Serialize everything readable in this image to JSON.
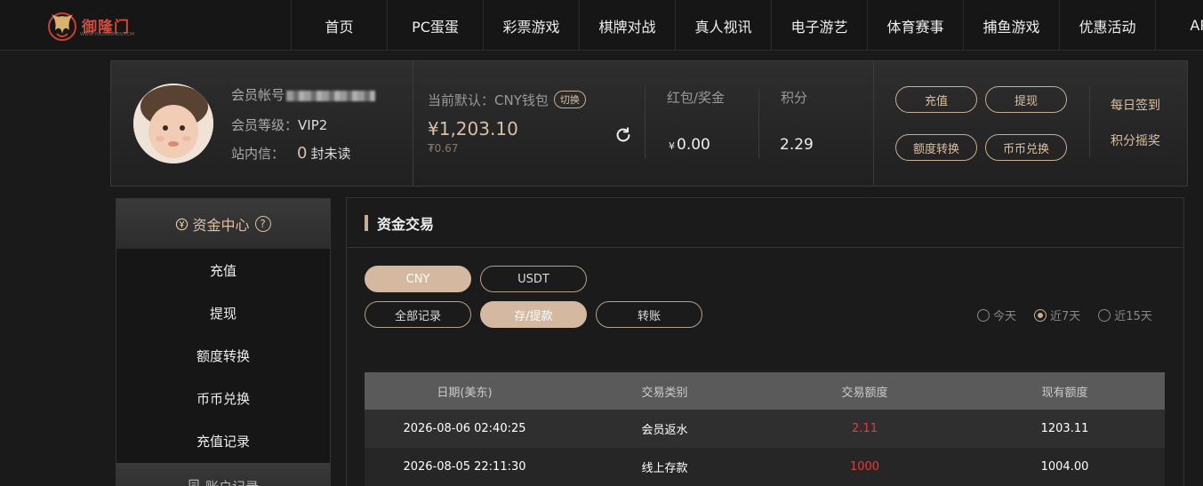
{
  "nav": {
    "logo_text": "御隆门",
    "logo_sub": "WWW.YULONGMEN.COM",
    "items": [
      "首页",
      "PC蛋蛋",
      "彩票游戏",
      "棋牌对战",
      "真人视讯",
      "电子游艺",
      "体育赛事",
      "捕鱼游戏",
      "优惠活动",
      "APP"
    ]
  },
  "user": {
    "account_label": "会员帐号",
    "level_label": "会员等级：",
    "level_value": "VIP2",
    "mail_label": "站内信：",
    "unread_count": "0",
    "unread_suffix": "封未读"
  },
  "wallet": {
    "label": "当前默认：CNY钱包",
    "switch_label": "切换",
    "amount": "¥1,203.10",
    "sub_amount": "₮0.67"
  },
  "stats": {
    "bonus_label": "红包/奖金",
    "bonus_currency": "¥",
    "bonus_value": "0.00",
    "points_label": "积分",
    "points_value": "2.29"
  },
  "actions": {
    "deposit": "充值",
    "withdraw": "提现",
    "transfer": "额度转换",
    "exchange": "币币兑换",
    "checkin": "每日签到",
    "points_lottery": "积分摇奖"
  },
  "sidebar": {
    "header": "资金中心",
    "help": "?",
    "items": [
      "充值",
      "提现",
      "额度转换",
      "币币兑换",
      "充值记录"
    ],
    "header2": "账户记录"
  },
  "main": {
    "title": "资金交易",
    "currency_tabs": [
      "CNY",
      "USDT"
    ],
    "type_tabs": [
      "全部记录",
      "存/提款",
      "转账"
    ],
    "ranges": [
      "今天",
      "近7天",
      "近15天"
    ],
    "columns": [
      "日期(美东)",
      "交易类别",
      "交易额度",
      "现有额度"
    ],
    "rows": [
      [
        "2026-08-06 02:40:25",
        "会员返水",
        "2.11",
        "1203.11"
      ],
      [
        "2026-08-05 22:11:30",
        "线上存款",
        "1000",
        "1004.00"
      ]
    ]
  },
  "colors": {
    "accent": "#d8c0a4",
    "tab_active_bg": "#d4b9a0",
    "amount_red": "#e03c3c"
  }
}
